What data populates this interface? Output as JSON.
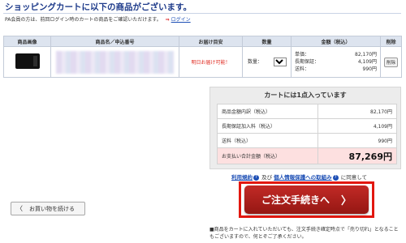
{
  "header": {
    "title": "ショッピングカートに以下の商品がございます。",
    "notice": "PA会員の方は、前回ログイン時のカートの商品をご確認いただけます。",
    "notice_arrow": "⇒",
    "login_link": "ログイン"
  },
  "cart_table": {
    "columns": [
      "商品画像",
      "商品名／申込番号",
      "お届け目安",
      "数量",
      "金額（税込）",
      "削除"
    ],
    "item": {
      "image_icon": "microwave-oven-image",
      "delivery": "明日お届け可能！",
      "quantity_label": "数量：",
      "quantity_value": "1",
      "price_label": "単価：",
      "price_value": "82,170円",
      "warranty_label": "長期保証：",
      "warranty_value": "4,109円",
      "shipping_label": "送料：",
      "shipping_value": "990円",
      "delete_label": "削除"
    }
  },
  "summary": {
    "title": "カートには1点入っています",
    "rows": [
      {
        "label": "商品金額内訳（税込）",
        "value": "82,170円"
      },
      {
        "label": "長期保証加入料（税込）",
        "value": "4,109円"
      },
      {
        "label": "送料（税込）",
        "value": "990円"
      }
    ],
    "total_label": "お支払い合計金額（税込）",
    "total_value": "87,269円"
  },
  "agreement": {
    "terms_link": "利用規約",
    "connector": "及び",
    "privacy_link": "個人情報保護への取組み",
    "suffix": "に同意して"
  },
  "order_button": {
    "label": "ご注文手続きへ",
    "chevron": "〉"
  },
  "continue_button": {
    "label": "お買い物を続ける",
    "chevron": "〈"
  },
  "footnote": "■商品をカートに入れていただいても、注文手続き確定時点で「売り切れ」となることもございますので、何とぞご了承ください。",
  "colors": {
    "accent": "#1d3a8a",
    "order_button": "#b0201c",
    "highlight_frame": "#e2170f",
    "total_bg": "#fde0e0"
  }
}
